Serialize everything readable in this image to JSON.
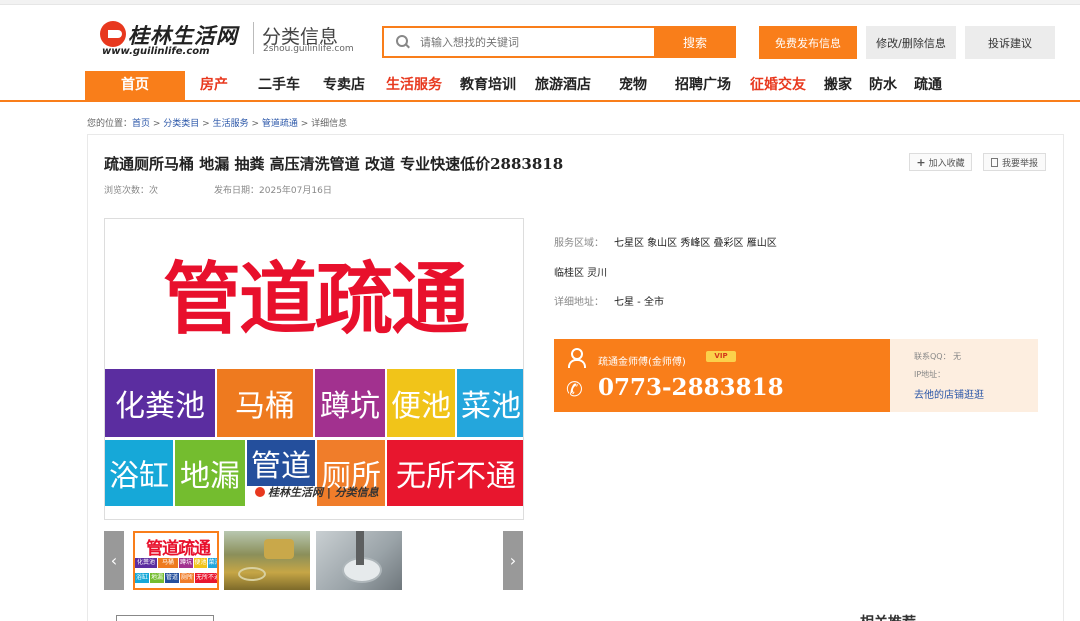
{
  "header": {
    "logo_name": "桂林生活网",
    "logo_domain": "www.guilinlife.com",
    "section_title": "分类信息",
    "section_domain": "2shou.guilinlife.com",
    "search_placeholder": "请输入想找的关键词",
    "search_button": "搜索",
    "publish_button": "免费发布信息",
    "edit_button": "修改/删除信息",
    "complain_button": "投诉建议"
  },
  "nav": {
    "items": [
      {
        "label": "首页"
      },
      {
        "label": "房产"
      },
      {
        "label": "二手车"
      },
      {
        "label": "专卖店"
      },
      {
        "label": "生活服务"
      },
      {
        "label": "教育培训"
      },
      {
        "label": "旅游酒店"
      },
      {
        "label": "宠物"
      },
      {
        "label": "招聘广场"
      },
      {
        "label": "征婚交友"
      },
      {
        "label": "搬家"
      },
      {
        "label": "防水"
      },
      {
        "label": "疏通"
      }
    ]
  },
  "breadcrumb": {
    "prefix": "您的位置：",
    "items": [
      "首页",
      "分类类目",
      "生活服务",
      "管道疏通"
    ],
    "current": "详细信息",
    "separator": " > "
  },
  "post": {
    "title": "疏通厕所马桶 地漏 抽粪 高压清洗管道 改道 专业快速低价2883818",
    "views_label": "浏览次数：",
    "views_suffix": "次",
    "date_label": "发布日期：",
    "date": "2025年07月16日",
    "favorite_button": "加入收藏",
    "report_button": "我要举报"
  },
  "image": {
    "headline": "管道疏通",
    "tiles": [
      {
        "text": "化粪池",
        "color": "#5b2da0"
      },
      {
        "text": "马桶",
        "color": "#ee7a1f"
      },
      {
        "text": "蹲坑",
        "color": "#a2318f"
      },
      {
        "text": "便池",
        "color": "#f1c419"
      },
      {
        "text": "菜池",
        "color": "#24a6dc"
      },
      {
        "text": "浴缸",
        "color": "#16a8d8"
      },
      {
        "text": "地漏",
        "color": "#74bd2f"
      },
      {
        "text": "管道",
        "color": "#244f9c"
      },
      {
        "text": "厕所",
        "color": "#f07d2a"
      },
      {
        "text": "无所不通",
        "color": "#e8162e"
      }
    ],
    "watermark": "桂林生活网 | 分类信息"
  },
  "thumbnails": {
    "prev": "‹",
    "next": "›"
  },
  "info": {
    "area_label": "服务区域：",
    "area_line1": "七星区 象山区 秀峰区 叠彩区 雁山区",
    "area_line2": "临桂区 灵川",
    "address_label": "详细地址：",
    "address": "七星 - 全市"
  },
  "contact": {
    "name": "疏通金师傅(金师傅)",
    "vip": "VIP",
    "phone": "0773-2883818",
    "qq_label": "联系QQ：",
    "qq_value": "无",
    "ip_label": "IP地址：",
    "shop_link": "去他的店铺逛逛"
  },
  "bottom": {
    "related_title": "相关推荐"
  },
  "colors": {
    "accent": "#f97e1a",
    "red": "#e8381e",
    "link": "#2a56a8"
  }
}
